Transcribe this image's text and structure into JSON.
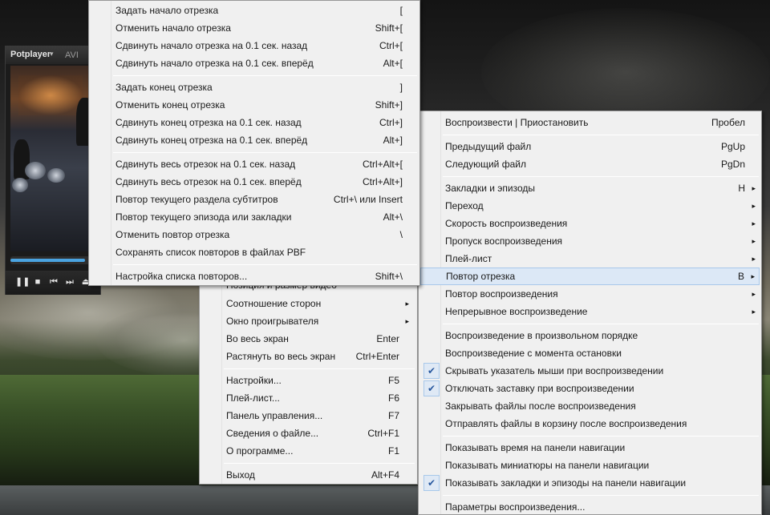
{
  "player": {
    "title": "Potplayer",
    "caret": "▾",
    "format": "AVI",
    "seek_progress": 0.88,
    "controls": [
      {
        "name": "pause-button",
        "glyph": "❚❚"
      },
      {
        "name": "stop-button",
        "glyph": "■"
      },
      {
        "name": "previous-button",
        "glyph": "⏮"
      },
      {
        "name": "next-button",
        "glyph": "⏭"
      },
      {
        "name": "eject-button",
        "glyph": "⏏"
      }
    ]
  },
  "main_menu": {
    "partial_item": "Позиция и размер видео",
    "items": [
      {
        "label": "Соотношение сторон",
        "arrow": "▸"
      },
      {
        "label": "Окно проигрывателя",
        "arrow": "▸"
      },
      {
        "label": "Во весь экран",
        "shortcut": "Enter"
      },
      {
        "label": "Растянуть во весь экран",
        "shortcut": "Ctrl+Enter"
      },
      {
        "label": "Настройки...",
        "shortcut": "F5"
      },
      {
        "label": "Плей-лист...",
        "shortcut": "F6"
      },
      {
        "label": "Панель управления...",
        "shortcut": "F7"
      },
      {
        "label": "Сведения о файле...",
        "shortcut": "Ctrl+F1"
      },
      {
        "label": "О программе...",
        "shortcut": "F1"
      },
      {
        "label": "Выход",
        "shortcut": "Alt+F4"
      }
    ]
  },
  "playback_menu": {
    "items": [
      {
        "label": "Воспроизвести | Приостановить",
        "shortcut": "Пробел"
      },
      {
        "label": "Предыдущий файл",
        "shortcut": "PgUp"
      },
      {
        "label": "Следующий файл",
        "shortcut": "PgDn"
      },
      {
        "label": "Закладки и эпизоды",
        "shortcut": "H",
        "arrow": "▸"
      },
      {
        "label": "Переход",
        "arrow": "▸"
      },
      {
        "label": "Скорость воспроизведения",
        "arrow": "▸"
      },
      {
        "label": "Пропуск воспроизведения",
        "arrow": "▸"
      },
      {
        "label": "Плей-лист",
        "arrow": "▸"
      },
      {
        "label": "Повтор отрезка",
        "shortcut": "B",
        "arrow": "▸",
        "highlighted": true
      },
      {
        "label": "Повтор воспроизведения",
        "arrow": "▸"
      },
      {
        "label": "Непрерывное воспроизведение",
        "arrow": "▸"
      },
      {
        "label": "Воспроизведение в произвольном порядке"
      },
      {
        "label": "Воспроизведение с момента остановки"
      },
      {
        "label": "Скрывать указатель мыши при воспроизведении",
        "checked": true
      },
      {
        "label": "Отключать заставку при воспроизведении",
        "checked": true
      },
      {
        "label": "Закрывать файлы после воспроизведения"
      },
      {
        "label": "Отправлять файлы в корзину после воспроизведения"
      },
      {
        "label": "Показывать время на панели навигации"
      },
      {
        "label": "Показывать миниатюры на панели навигации"
      },
      {
        "label": "Показывать закладки и эпизоды на панели навигации",
        "checked": true
      },
      {
        "label": "Параметры воспроизведения..."
      }
    ],
    "check_glyph": "✔"
  },
  "ab_repeat_menu": {
    "items": [
      {
        "label": "Задать начало отрезка",
        "shortcut": "["
      },
      {
        "label": "Отменить начало отрезка",
        "shortcut": "Shift+["
      },
      {
        "label": "Сдвинуть начало отрезка на 0.1 сек. назад",
        "shortcut": "Ctrl+["
      },
      {
        "label": "Сдвинуть начало отрезка на 0.1 сек. вперёд",
        "shortcut": "Alt+["
      },
      {
        "label": "Задать конец отрезка",
        "shortcut": "]"
      },
      {
        "label": "Отменить конец отрезка",
        "shortcut": "Shift+]"
      },
      {
        "label": "Сдвинуть конец отрезка на 0.1 сек. назад",
        "shortcut": "Ctrl+]"
      },
      {
        "label": "Сдвинуть конец отрезка на 0.1 сек. вперёд",
        "shortcut": "Alt+]"
      },
      {
        "label": "Сдвинуть весь отрезок на 0.1 сек. назад",
        "shortcut": "Ctrl+Alt+["
      },
      {
        "label": "Сдвинуть весь отрезок на 0.1 сек. вперёд",
        "shortcut": "Ctrl+Alt+]"
      },
      {
        "label": "Повтор текущего раздела субтитров",
        "shortcut": "Ctrl+\\ или Insert"
      },
      {
        "label": "Повтор текущего эпизода или закладки",
        "shortcut": "Alt+\\"
      },
      {
        "label": "Отменить повтор отрезка",
        "shortcut": "\\"
      },
      {
        "label": "Сохранять список повторов в файлах PBF"
      },
      {
        "label": "Настройка списка повторов...",
        "shortcut": "Shift+\\"
      }
    ]
  }
}
